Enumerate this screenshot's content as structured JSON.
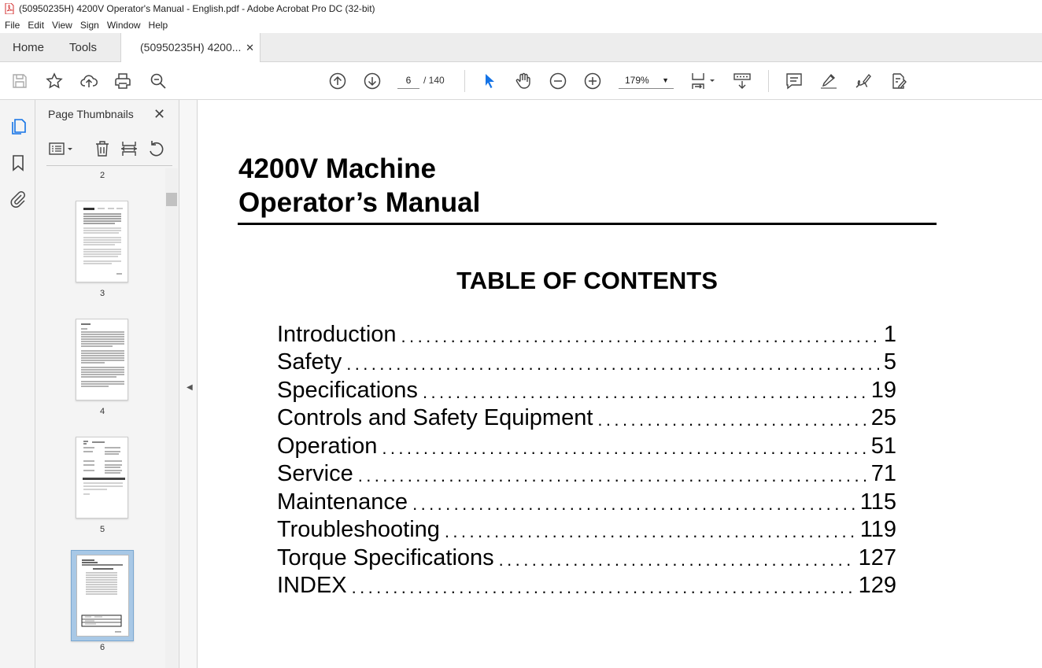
{
  "window": {
    "title": "(50950235H) 4200V Operator's Manual - English.pdf - Adobe Acrobat Pro DC (32-bit)"
  },
  "menu": [
    "File",
    "Edit",
    "View",
    "Sign",
    "Window",
    "Help"
  ],
  "tabs": {
    "home": "Home",
    "tools": "Tools",
    "document": "(50950235H) 4200..."
  },
  "toolbar": {
    "current_page": "6",
    "page_total": "/ 140",
    "zoom": "179%"
  },
  "panel": {
    "title": "Page Thumbnails",
    "page_labels": [
      "2",
      "3",
      "4",
      "5",
      "6"
    ]
  },
  "document": {
    "title_line1": "4200V Machine",
    "title_line2": "Operator’s Manual",
    "toc_heading": "TABLE OF CONTENTS",
    "toc": [
      {
        "label": "Introduction",
        "page": "1"
      },
      {
        "label": "Safety",
        "page": "5"
      },
      {
        "label": "Specifications",
        "page": "19"
      },
      {
        "label": "Controls and Safety Equipment",
        "page": "25"
      },
      {
        "label": "Operation",
        "page": "51"
      },
      {
        "label": "Service",
        "page": "71"
      },
      {
        "label": "Maintenance",
        "page": "115"
      },
      {
        "label": "Troubleshooting",
        "page": "119"
      },
      {
        "label": "Torque Specifications",
        "page": "127"
      },
      {
        "label": "INDEX",
        "page": "129"
      }
    ]
  },
  "colors": {
    "accent": "#1473e6",
    "pdf_red": "#d32f2f",
    "selection": "#a8c8e6"
  }
}
